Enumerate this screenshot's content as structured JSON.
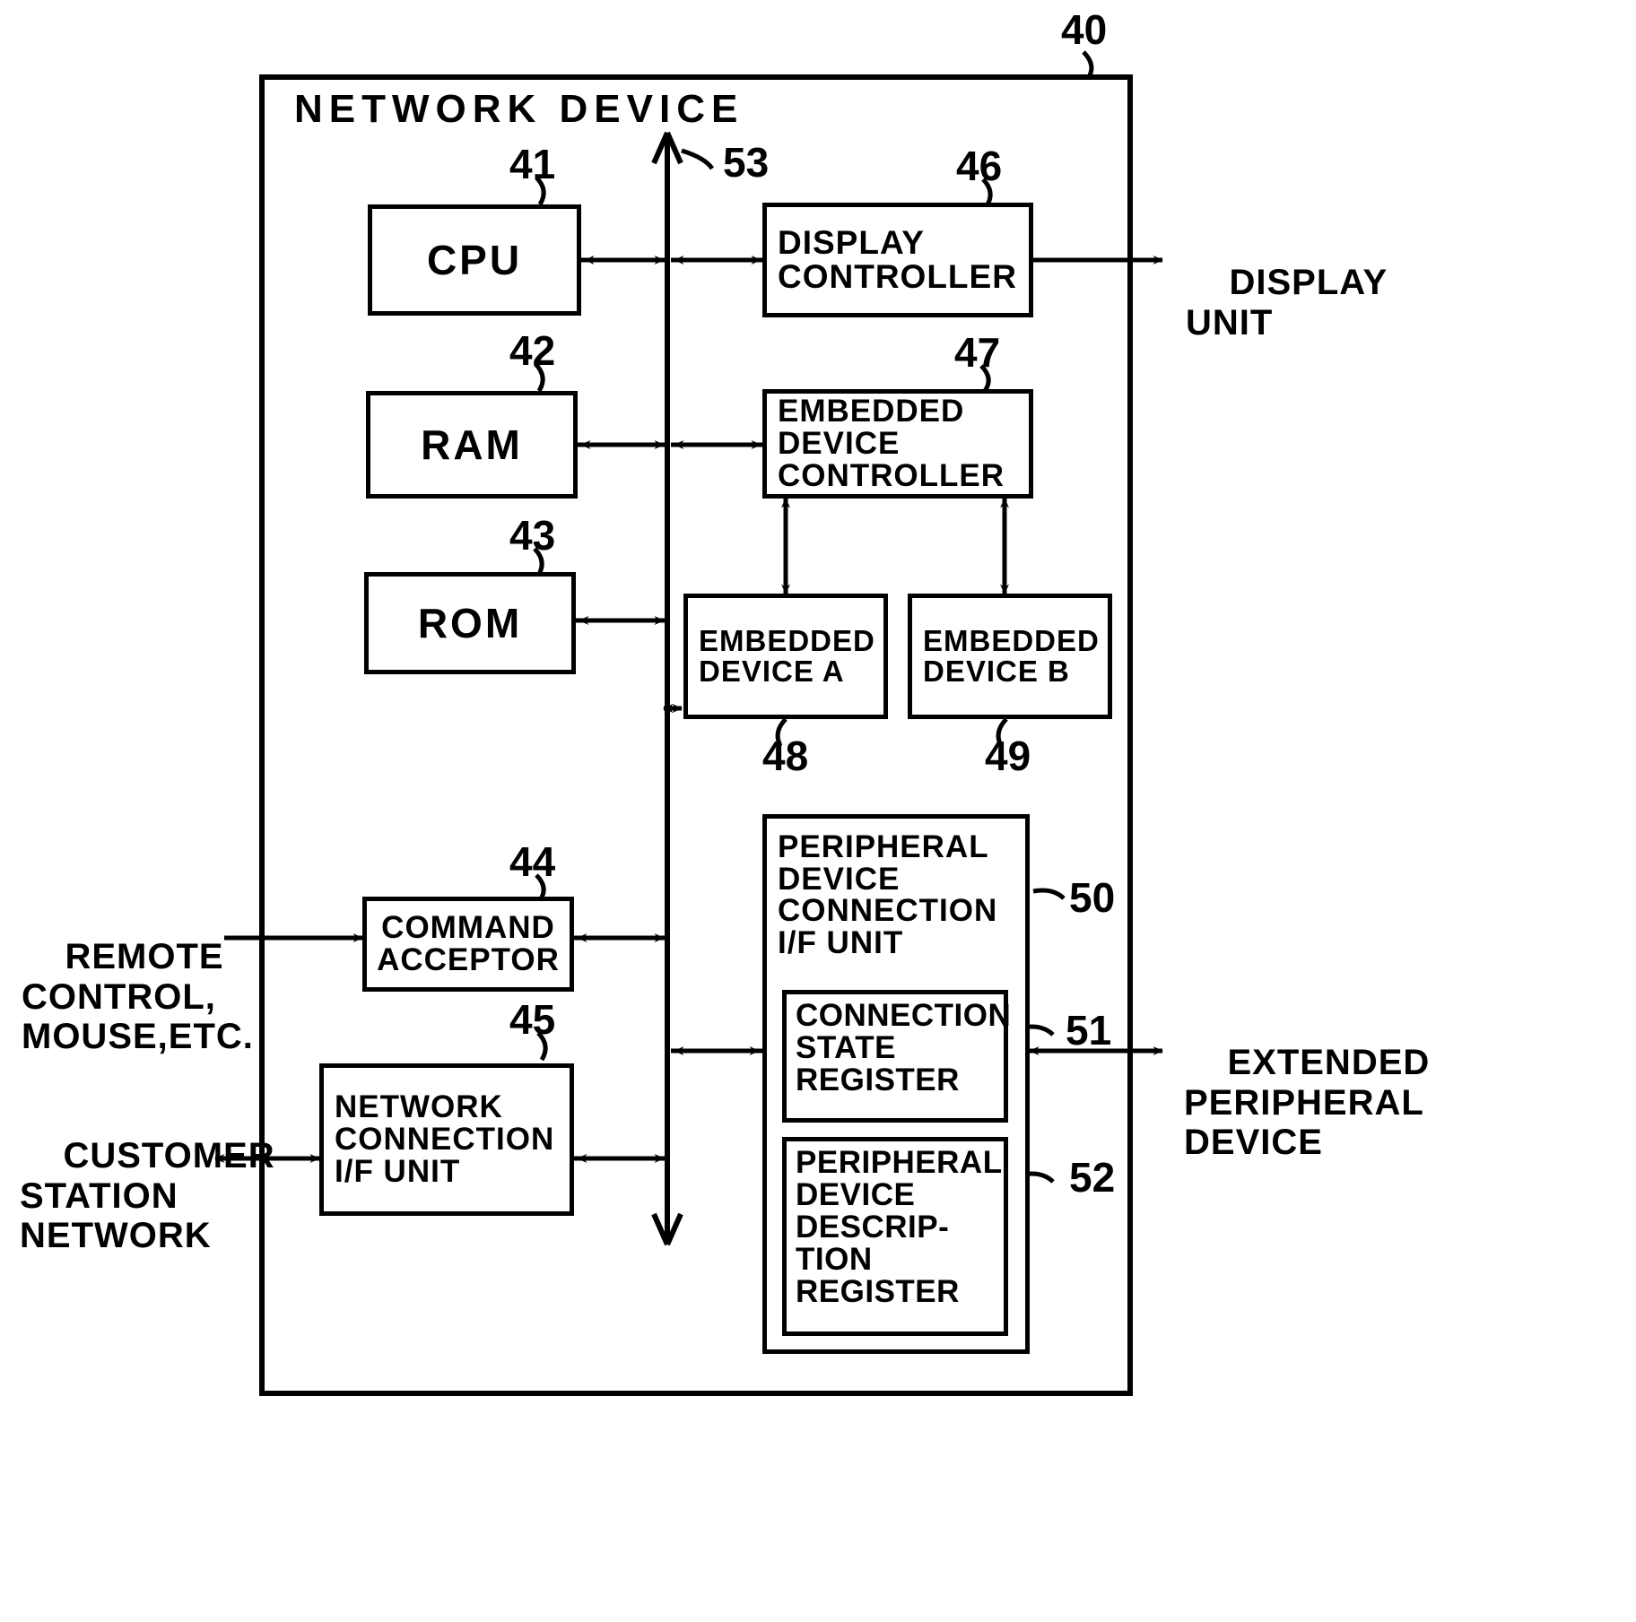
{
  "figure": {
    "title": "NETWORK DEVICE",
    "outer_ref": "40"
  },
  "blocks": [
    {
      "id": "cpu",
      "label": "CPU",
      "ref": "41"
    },
    {
      "id": "ram",
      "label": "RAM",
      "ref": "42"
    },
    {
      "id": "rom",
      "label": "ROM",
      "ref": "43"
    },
    {
      "id": "command",
      "label": "COMMAND\nACCEPTOR",
      "ref": "44"
    },
    {
      "id": "netif",
      "label": "NETWORK\nCONNECTION\nI/F UNIT",
      "ref": "45"
    },
    {
      "id": "dispctl",
      "label": "DISPLAY\nCONTROLLER",
      "ref": "46"
    },
    {
      "id": "embctl",
      "label": "EMBEDDED\nDEVICE\nCONTROLLER",
      "ref": "47"
    },
    {
      "id": "embdeva",
      "label": "EMBEDDED\nDEVICE A",
      "ref": "48"
    },
    {
      "id": "embdevb",
      "label": "EMBEDDED\nDEVICE B",
      "ref": "49"
    },
    {
      "id": "periphif",
      "label": "PERIPHERAL\nDEVICE\nCONNECTION\nI/F UNIT",
      "ref": "50"
    },
    {
      "id": "connreg",
      "label": "CONNECTION\nSTATE\nREGISTER",
      "ref": "51"
    },
    {
      "id": "descreg",
      "label": "PERIPHERAL\nDEVICE\nDESCRIP-\nTION\nREGISTER",
      "ref": "52"
    }
  ],
  "bus": {
    "ref": "53"
  },
  "external": {
    "remote": "REMOTE\nCONTROL,\nMOUSE,ETC.",
    "customer": "CUSTOMER\nSTATION\nNETWORK",
    "display": "DISPLAY\nUNIT",
    "extperiph": "EXTENDED\nPERIPHERAL\nDEVICE"
  },
  "colors": {
    "ink": "#000000",
    "paper": "#ffffff"
  }
}
